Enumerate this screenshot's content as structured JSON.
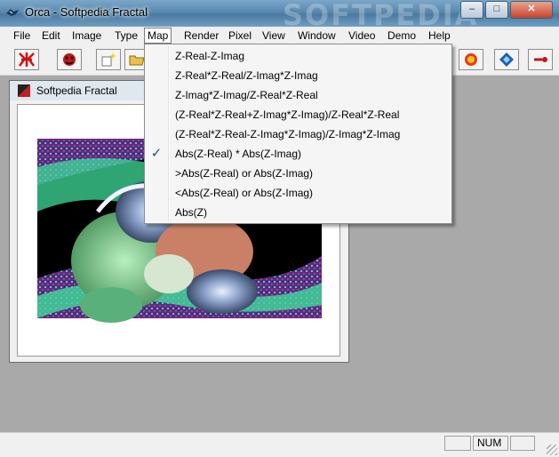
{
  "window": {
    "title": "Orca - Softpedia Fractal",
    "watermark": "SOFTPEDIA",
    "controls": {
      "minimize": "–",
      "maximize": "□",
      "close": "✕"
    }
  },
  "menubar": {
    "items": [
      "File",
      "Edit",
      "Image",
      "Type",
      "Map",
      "Render",
      "Pixel",
      "View",
      "Window",
      "Video",
      "Demo",
      "Help"
    ],
    "active": "Map"
  },
  "toolbar": {
    "icons": [
      "fractal-star-icon",
      "ladybug-icon",
      "new-sparkle-icon",
      "open-folder-icon",
      "render-ball-icon",
      "diamond-icon",
      "pointer-icon"
    ]
  },
  "child_window": {
    "title": "Softpedia Fractal"
  },
  "map_menu": {
    "items": [
      {
        "label": "Z-Real-Z-Imag",
        "checked": false
      },
      {
        "label": "Z-Real*Z-Real/Z-Imag*Z-Imag",
        "checked": false
      },
      {
        "label": "Z-Imag*Z-Imag/Z-Real*Z-Real",
        "checked": false
      },
      {
        "label": "(Z-Real*Z-Real+Z-Imag*Z-Imag)/Z-Real*Z-Real",
        "checked": false
      },
      {
        "label": "(Z-Real*Z-Real-Z-Imag*Z-Imag)/Z-Imag*Z-Imag",
        "checked": false
      },
      {
        "label": "Abs(Z-Real) * Abs(Z-Imag)",
        "checked": true
      },
      {
        "label": ">Abs(Z-Real) or Abs(Z-Imag)",
        "checked": false
      },
      {
        "label": "<Abs(Z-Real) or Abs(Z-Imag)",
        "checked": false
      },
      {
        "label": "Abs(Z)",
        "checked": false
      }
    ],
    "check_glyph": "✓"
  },
  "statusbar": {
    "num": "NUM"
  },
  "colors": {
    "fractal_green": "#3fdc9a",
    "fractal_purple": "#7a3fa0",
    "check_blue": "#1b4f9c"
  }
}
